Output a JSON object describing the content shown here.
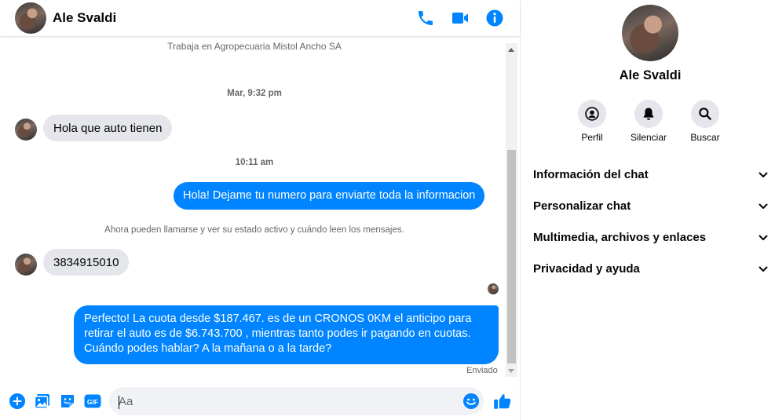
{
  "header": {
    "contact_name": "Ale Svaldi"
  },
  "conversation": {
    "work_info": "Trabaja en Agropecuaria Mistol Ancho SA",
    "timestamps": [
      "Mar, 9:32 pm",
      "10:11 am"
    ],
    "notice": "Ahora pueden llamarse y ver su estado activo y cuándo leen los mensajes.",
    "messages": [
      {
        "direction": "incoming",
        "text": "Hola que auto tienen"
      },
      {
        "direction": "outgoing",
        "text": "Hola! Dejame tu numero  para enviarte toda la informacion"
      },
      {
        "direction": "incoming",
        "text": "3834915010"
      },
      {
        "direction": "outgoing",
        "lines": [
          "Perfecto! La cuota desde $187.467. es de un CRONOS 0KM el anticipo para",
          "retirar el auto es de $6.743.700 , mientras tanto podes ir pagando en cuotas.",
          "Cuándo podes hablar? A la mañana o a la tarde?"
        ]
      }
    ],
    "status": "Enviado"
  },
  "composer": {
    "placeholder": "Aa",
    "gif_label": "GIF"
  },
  "panel": {
    "name": "Ale Svaldi",
    "actions": [
      {
        "label": "Perfil",
        "icon": "profile-icon"
      },
      {
        "label": "Silenciar",
        "icon": "bell-icon"
      },
      {
        "label": "Buscar",
        "icon": "search-icon"
      }
    ],
    "sections": [
      "Información del chat",
      "Personalizar chat",
      "Multimedia, archivos y enlaces",
      "Privacidad y ayuda"
    ]
  },
  "colors": {
    "accent": "#0084ff",
    "incoming_bubble": "#e4e6eb",
    "secondary_text": "#65676b"
  }
}
